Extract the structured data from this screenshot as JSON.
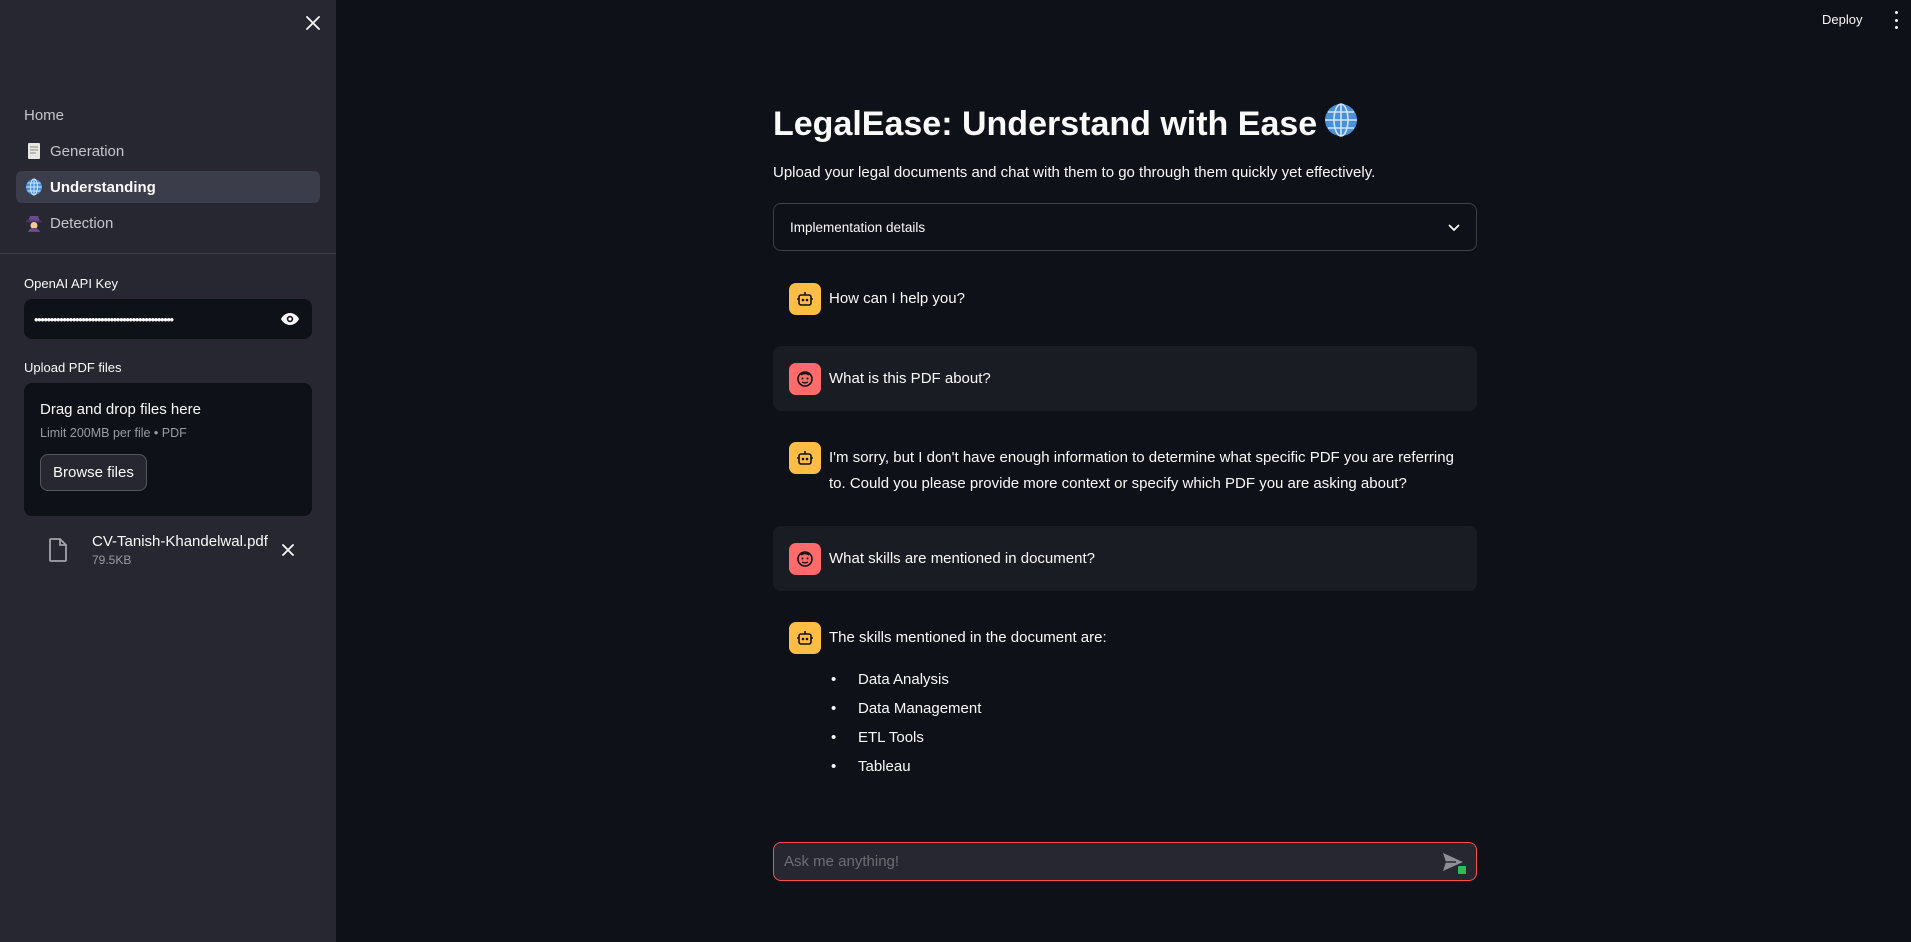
{
  "sidebar": {
    "nav": [
      {
        "label": "Home",
        "icon": "none"
      },
      {
        "label": "Generation",
        "icon": "page-icon"
      },
      {
        "label": "Understanding",
        "icon": "globe-icon"
      },
      {
        "label": "Detection",
        "icon": "detective-icon"
      }
    ],
    "api_key_label": "OpenAI API Key",
    "api_key_value": "••••••••••••••••••••••••••••••••••••••••••••",
    "upload_label": "Upload PDF files",
    "dropzone_title": "Drag and drop files here",
    "dropzone_limit": "Limit 200MB per file • PDF",
    "browse_label": "Browse files",
    "file_name": "CV-Tanish-Khandelwal.pdf",
    "file_size": "79.5KB"
  },
  "header": {
    "deploy_label": "Deploy"
  },
  "main": {
    "title": "LegalEase: Understand with Ease",
    "subtitle": "Upload your legal documents and chat with them to go through them quickly yet effectively.",
    "expander_label": "Implementation details",
    "messages": [
      {
        "role": "assistant",
        "text": "How can I help you?"
      },
      {
        "role": "user",
        "text": "What is this PDF about?"
      },
      {
        "role": "assistant",
        "text": "I'm sorry, but I don't have enough information to determine what specific PDF you are referring to. Could you please provide more context or specify which PDF you are asking about?"
      },
      {
        "role": "user",
        "text": "What skills are mentioned in document?"
      },
      {
        "role": "assistant",
        "text": "The skills mentioned in the document are:",
        "list": [
          "Data Analysis",
          "Data Management",
          "ETL Tools",
          "Tableau"
        ]
      }
    ],
    "chat_placeholder": "Ask me anything!"
  },
  "colors": {
    "background": "#0e1117",
    "sidebar": "#262730",
    "accent": "#ff4b4b",
    "bot_avatar": "#ffbd45",
    "user_avatar": "#ff6b6b"
  }
}
